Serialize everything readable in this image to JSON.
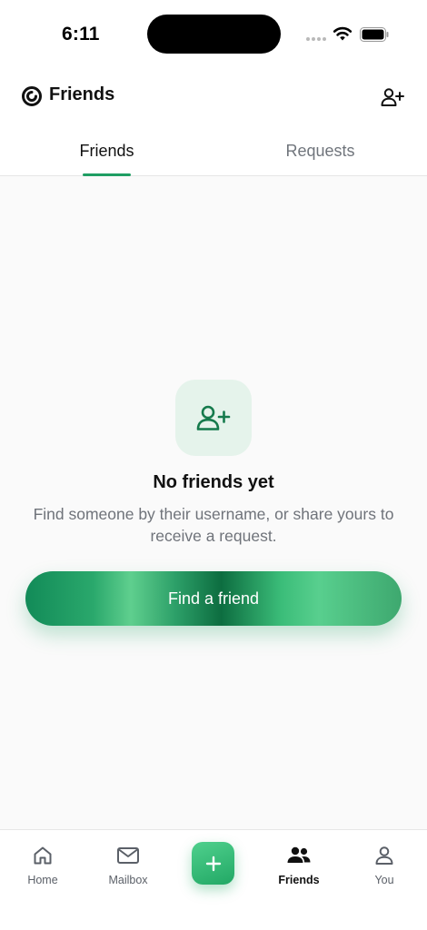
{
  "status_bar": {
    "time": "6:11"
  },
  "header": {
    "title": "Friends"
  },
  "tabs": [
    {
      "label": "Friends",
      "active": true
    },
    {
      "label": "Requests",
      "active": false
    }
  ],
  "empty_state": {
    "title": "No friends yet",
    "description": "Find someone by their username, or share yours to receive a request.",
    "button_label": "Find a friend"
  },
  "bottom_nav": {
    "home": {
      "label": "Home",
      "icon": "home-icon"
    },
    "mailbox": {
      "label": "Mailbox",
      "icon": "mail-icon"
    },
    "add": {
      "icon": "plus-icon"
    },
    "friends": {
      "label": "Friends",
      "icon": "people-icon",
      "active": true
    },
    "you": {
      "label": "You",
      "icon": "person-icon"
    }
  },
  "colors": {
    "accent": "#1f9e63",
    "accent_light": "#e5f3eb",
    "text_primary": "#111111",
    "text_secondary": "#6f737a"
  }
}
